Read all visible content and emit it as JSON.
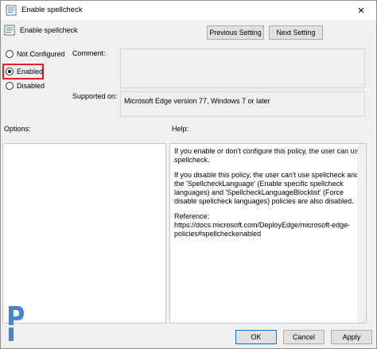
{
  "window": {
    "title": "Enable spellcheck",
    "close_glyph": "✕"
  },
  "header": {
    "setting_name": "Enable spellcheck",
    "prev_button": "Previous Setting",
    "next_button": "Next Setting"
  },
  "state": {
    "options": [
      {
        "label": "Not Configured",
        "selected": false
      },
      {
        "label": "Enabled",
        "selected": true
      },
      {
        "label": "Disabled",
        "selected": false
      }
    ]
  },
  "comment": {
    "label": "Comment:",
    "value": ""
  },
  "supported": {
    "label": "Supported on:",
    "value": "Microsoft Edge version 77, Windows 7 or later"
  },
  "options_panel": {
    "label": "Options:"
  },
  "help_panel": {
    "label": "Help:",
    "paragraphs": [
      "If you enable or don't configure this policy, the user can use spellcheck.",
      "If you disable this policy, the user can't use spellcheck and the 'SpellcheckLanguage' (Enable specific spellcheck languages) and 'SpellcheckLanguageBlocklist' (Force disable spellcheck languages) policies are also disabled.",
      "Reference: https://docs.microsoft.com/DeployEdge/microsoft-edge-policies#spellcheckenabled"
    ]
  },
  "footer": {
    "ok": "OK",
    "cancel": "Cancel",
    "apply": "Apply"
  },
  "colors": {
    "highlight": "#e02424",
    "default_button_border": "#0078d7",
    "logo": "#4a86c5"
  },
  "icons": {
    "title": "policy-setting-icon",
    "setting": "policy-setting-icon",
    "close": "close-icon",
    "logo": "brand-logo-icon"
  }
}
